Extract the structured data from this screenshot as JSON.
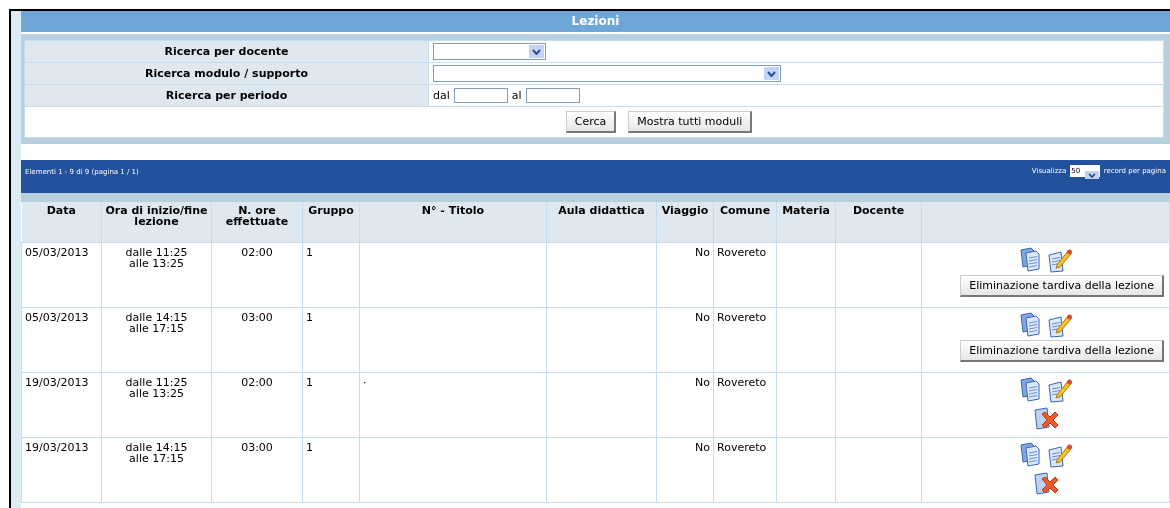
{
  "title": "Lezioni",
  "search": {
    "rows": [
      {
        "kind": "short_select",
        "label": "Ricerca per docente"
      },
      {
        "kind": "long_select",
        "label": "Ricerca modulo / supporto"
      },
      {
        "kind": "period",
        "label": "Ricerca per periodo",
        "from_label": "dal",
        "to_label": "al"
      }
    ],
    "buttons": [
      "Cerca",
      "Mostra tutti moduli"
    ]
  },
  "pager": {
    "summary": "Elementi 1 - 9 di 9 (pagina 1 / 1)",
    "show_label": "Visualizza",
    "page_size": "50",
    "suffix": "record per pagina"
  },
  "table": {
    "columns": [
      "Data",
      "Ora di inizio/fine lezione",
      "N. ore effettuate",
      "Gruppo",
      "N° - Titolo",
      "Aula didattica",
      "Viaggio",
      "Comune",
      "Materia",
      "Docente"
    ],
    "rows": [
      {
        "data": "05/03/2013",
        "start": "dalle 11:25",
        "end": "alle 13:25",
        "hours": "02:00",
        "group": "1",
        "title": "",
        "room": "",
        "trip": "No",
        "town": "Rovereto",
        "subject": "",
        "teacher": "",
        "action": {
          "kind": "button",
          "label": "Eliminazione tardiva della lezione"
        }
      },
      {
        "data": "05/03/2013",
        "start": "dalle 14:15",
        "end": "alle 17:15",
        "hours": "03:00",
        "group": "1",
        "title": "",
        "room": "",
        "trip": "No",
        "town": "Rovereto",
        "subject": "",
        "teacher": "",
        "action": {
          "kind": "button",
          "label": "Eliminazione tardiva della lezione"
        }
      },
      {
        "data": "19/03/2013",
        "start": "dalle 11:25",
        "end": "alle 13:25",
        "hours": "02:00",
        "group": "1",
        "title": "·",
        "room": "",
        "trip": "No",
        "town": "Rovereto",
        "subject": "",
        "teacher": "",
        "action": {
          "kind": "delete_icon"
        }
      },
      {
        "data": "19/03/2013",
        "start": "dalle 14:15",
        "end": "alle 17:15",
        "hours": "03:00",
        "group": "1",
        "title": "",
        "room": "",
        "trip": "No",
        "town": "Rovereto",
        "subject": "",
        "teacher": "",
        "action": {
          "kind": "delete_icon"
        }
      }
    ]
  }
}
